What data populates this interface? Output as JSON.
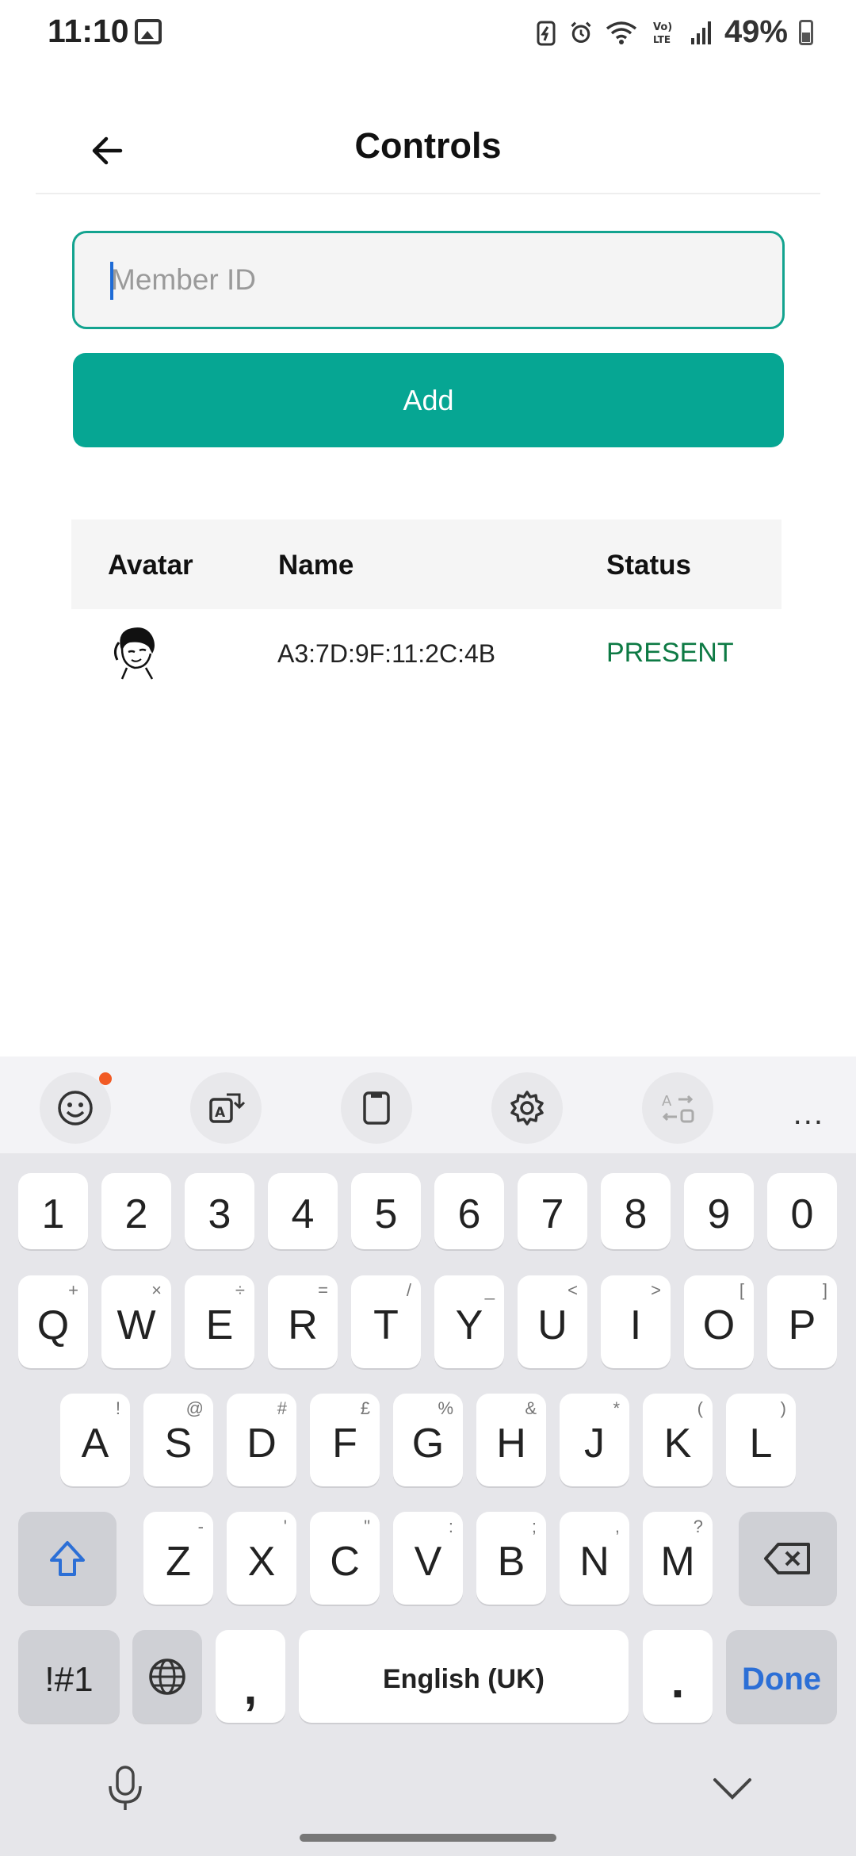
{
  "status_bar": {
    "time": "11:10",
    "battery": "49%",
    "icons": [
      "gallery-icon",
      "battery-saver-icon",
      "alarm-icon",
      "wifi-icon",
      "volte-icon",
      "signal-icon",
      "battery-icon"
    ]
  },
  "header": {
    "title": "Controls",
    "back_icon": "arrow-left-icon"
  },
  "form": {
    "member_placeholder": "Member ID",
    "member_value": "",
    "add_label": "Add"
  },
  "table": {
    "headers": [
      "Avatar",
      "Name",
      "Status"
    ],
    "rows": [
      {
        "avatar": "avatar-image",
        "name": "A3:7D:9F:11:2C:4B",
        "status": "PRESENT"
      }
    ]
  },
  "colors": {
    "accent": "#06a693",
    "input_border": "#13a38f",
    "status_present": "#0d7a44",
    "done_blue": "#2c6fd6"
  },
  "keyboard": {
    "toolbar": [
      "emoji-icon",
      "translate-icon",
      "clipboard-icon",
      "settings-icon",
      "text-convert-icon"
    ],
    "more": "...",
    "numbers": [
      "1",
      "2",
      "3",
      "4",
      "5",
      "6",
      "7",
      "8",
      "9",
      "0"
    ],
    "row1": [
      {
        "k": "Q",
        "a": "+"
      },
      {
        "k": "W",
        "a": "×"
      },
      {
        "k": "E",
        "a": "÷"
      },
      {
        "k": "R",
        "a": "="
      },
      {
        "k": "T",
        "a": "/"
      },
      {
        "k": "Y",
        "a": "_"
      },
      {
        "k": "U",
        "a": "<"
      },
      {
        "k": "I",
        "a": ">"
      },
      {
        "k": "O",
        "a": "["
      },
      {
        "k": "P",
        "a": "]"
      }
    ],
    "row2": [
      {
        "k": "A",
        "a": "!"
      },
      {
        "k": "S",
        "a": "@"
      },
      {
        "k": "D",
        "a": "#"
      },
      {
        "k": "F",
        "a": "£"
      },
      {
        "k": "G",
        "a": "%"
      },
      {
        "k": "H",
        "a": "&"
      },
      {
        "k": "J",
        "a": "*"
      },
      {
        "k": "K",
        "a": "("
      },
      {
        "k": "L",
        "a": ")"
      }
    ],
    "row3": [
      {
        "k": "Z",
        "a": "-"
      },
      {
        "k": "X",
        "a": "'"
      },
      {
        "k": "C",
        "a": "\""
      },
      {
        "k": "V",
        "a": ":"
      },
      {
        "k": "B",
        "a": ";"
      },
      {
        "k": "N",
        "a": ","
      },
      {
        "k": "M",
        "a": "?"
      }
    ],
    "symbols": "!#1",
    "comma": ",",
    "space": "English (UK)",
    "period": ".",
    "done": "Done"
  }
}
